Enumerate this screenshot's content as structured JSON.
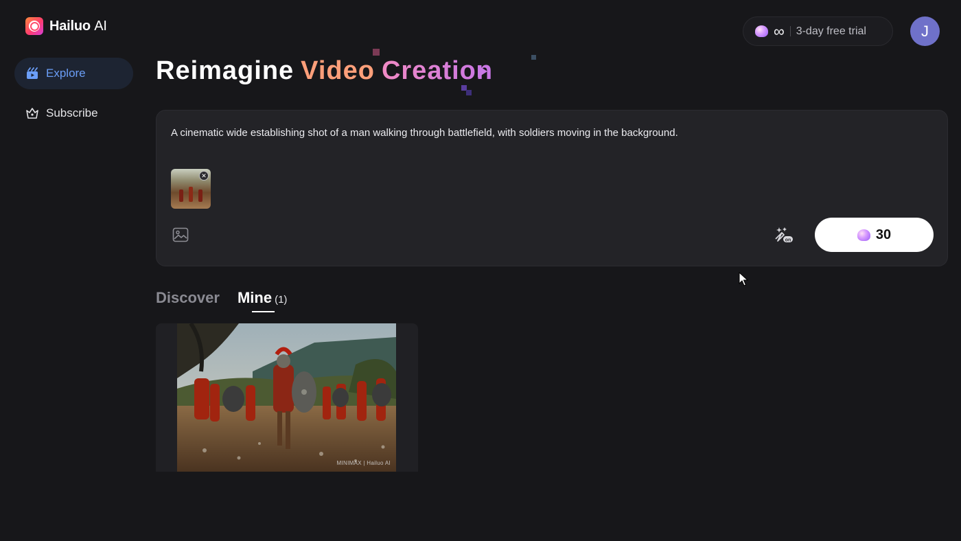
{
  "brand": {
    "name": "Hailuo",
    "suffix": "AI"
  },
  "sidebar": {
    "items": [
      {
        "label": "Explore",
        "icon": "explore-icon",
        "active": true
      },
      {
        "label": "Subscribe",
        "icon": "subscribe-icon",
        "active": false
      }
    ]
  },
  "topbar": {
    "trial_label": "3-day free trial",
    "credits_symbol": "∞",
    "avatar_initial": "J"
  },
  "headline": {
    "word1": "Reimagine",
    "word2": "Video",
    "word3": "Creation"
  },
  "prompt": {
    "text": "A cinematic wide establishing shot of a man walking through battlefield, with soldiers moving in the background.",
    "generate_cost": "30"
  },
  "tabs": [
    {
      "label": "Discover",
      "active": false
    },
    {
      "label": "Mine",
      "count": "(1)",
      "active": true
    }
  ],
  "video": {
    "watermark": "MINIMAX | Hailuo AI"
  },
  "colors": {
    "background": "#17171a",
    "accent_blue": "#6b9ef7",
    "headline_orange": "#ff9f7a",
    "headline_pink": "#e882c8",
    "avatar": "#6f71c9"
  }
}
